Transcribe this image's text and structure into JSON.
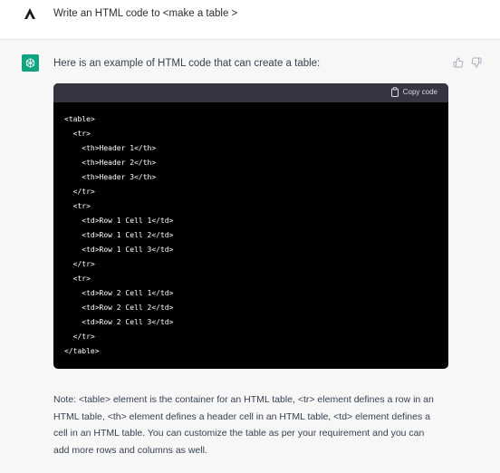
{
  "user_message": {
    "avatar_icon": "user-avatar-icon",
    "text": "Write an HTML code to <make a table >"
  },
  "assistant_message": {
    "avatar_icon": "openai-logo-icon",
    "avatar_color": "#10a37f",
    "intro": "Here is an example of HTML code that can create a table:",
    "feedback": {
      "thumbs_up_icon": "thumbs-up-icon",
      "thumbs_down_icon": "thumbs-down-icon"
    },
    "code_block": {
      "copy_label": "Copy code",
      "copy_icon": "clipboard-icon",
      "lines": [
        "<table>",
        "  <tr>",
        "    <th>Header 1</th>",
        "    <th>Header 2</th>",
        "    <th>Header 3</th>",
        "  </tr>",
        "  <tr>",
        "    <td>Row 1 Cell 1</td>",
        "    <td>Row 1 Cell 2</td>",
        "    <td>Row 1 Cell 3</td>",
        "  </tr>",
        "  <tr>",
        "    <td>Row 2 Cell 1</td>",
        "    <td>Row 2 Cell 2</td>",
        "    <td>Row 2 Cell 3</td>",
        "  </tr>",
        "</table>"
      ]
    },
    "note": "Note: <table> element is the container for an HTML table, <tr> element defines a row in an HTML table, <th> element defines a header cell in an HTML table, <td> element defines a cell in an HTML table. You can customize the table as per your requirement and you can add more rows and columns as well."
  }
}
